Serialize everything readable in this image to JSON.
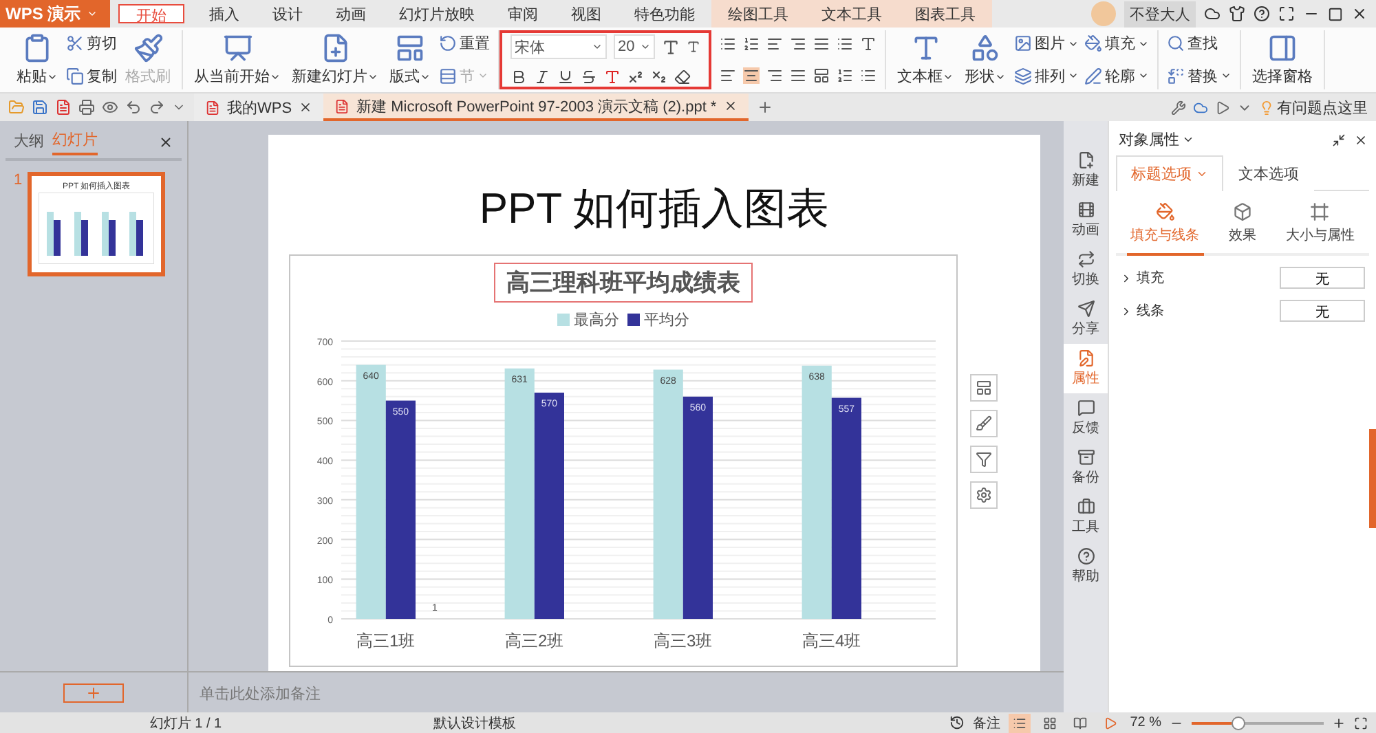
{
  "app": {
    "name": "WPS 演示"
  },
  "ribbon_tabs": [
    {
      "label": "开始",
      "selected": true,
      "kind": "normal"
    },
    {
      "label": "插入",
      "selected": false,
      "kind": "normal"
    },
    {
      "label": "设计",
      "selected": false,
      "kind": "normal"
    },
    {
      "label": "动画",
      "selected": false,
      "kind": "normal"
    },
    {
      "label": "幻灯片放映",
      "selected": false,
      "kind": "normal"
    },
    {
      "label": "审阅",
      "selected": false,
      "kind": "normal"
    },
    {
      "label": "视图",
      "selected": false,
      "kind": "normal"
    },
    {
      "label": "特色功能",
      "selected": false,
      "kind": "normal"
    },
    {
      "label": "绘图工具",
      "selected": false,
      "kind": "context"
    },
    {
      "label": "文本工具",
      "selected": false,
      "kind": "context"
    },
    {
      "label": "图表工具",
      "selected": false,
      "kind": "context"
    }
  ],
  "user": {
    "name": "不登大人"
  },
  "ribbon": [
    {
      "kind": "buttons",
      "items": [
        {
          "label": "粘贴",
          "kind": "large",
          "dropdown": true,
          "disabled": false
        },
        {
          "label": "剪切",
          "kind": "small",
          "dropdown": false,
          "disabled": false
        },
        {
          "label": "复制",
          "kind": "small",
          "dropdown": false,
          "disabled": false
        },
        {
          "label": "格式刷",
          "kind": "large",
          "dropdown": false,
          "disabled": true
        }
      ]
    },
    {
      "kind": "buttons",
      "items": [
        {
          "label": "从当前开始",
          "kind": "large",
          "dropdown": true,
          "disabled": false
        },
        {
          "label": "新建幻灯片",
          "kind": "large",
          "dropdown": true,
          "disabled": false
        },
        {
          "label": "版式",
          "kind": "large",
          "dropdown": true,
          "disabled": false
        },
        {
          "label": "重置",
          "kind": "small",
          "dropdown": false,
          "disabled": false
        },
        {
          "label": "节",
          "kind": "small",
          "dropdown": true,
          "disabled": true
        }
      ]
    },
    {
      "kind": "font",
      "font_name": "宋体",
      "font_size": "20"
    },
    {
      "kind": "paragraph"
    },
    {
      "kind": "buttons",
      "items": [
        {
          "label": "文本框",
          "kind": "large",
          "dropdown": true,
          "disabled": false
        },
        {
          "label": "形状",
          "kind": "large",
          "dropdown": true,
          "disabled": false
        },
        {
          "label": "图片",
          "kind": "small",
          "dropdown": true,
          "disabled": false
        },
        {
          "label": "排列",
          "kind": "small",
          "dropdown": true,
          "disabled": false
        },
        {
          "label": "填充",
          "kind": "small",
          "dropdown": true,
          "disabled": false
        },
        {
          "label": "轮廓",
          "kind": "small",
          "dropdown": true,
          "disabled": false
        }
      ]
    },
    {
      "kind": "buttons",
      "items": [
        {
          "label": "查找",
          "kind": "small",
          "dropdown": false,
          "disabled": false
        },
        {
          "label": "替换",
          "kind": "small",
          "dropdown": true,
          "disabled": false
        }
      ]
    },
    {
      "kind": "buttons",
      "items": [
        {
          "label": "选择窗格",
          "kind": "large",
          "dropdown": false,
          "disabled": false
        }
      ]
    }
  ],
  "doc_tabs": [
    {
      "label": "我的WPS",
      "selected": false
    },
    {
      "label": "新建 Microsoft PowerPoint 97-2003 演示文稿 (2).ppt *",
      "selected": true
    }
  ],
  "help_link": "有问题点这里",
  "left_panel": {
    "tabs": [
      {
        "label": "大纲",
        "selected": false
      },
      {
        "label": "幻灯片",
        "selected": true
      }
    ],
    "slides": [
      {
        "number": "1",
        "thumbnail_title": "PPT 如何插入图表",
        "selected": true
      }
    ]
  },
  "slide": {
    "title": "PPT 如何插入图表",
    "chart": {
      "chart_data": {
        "type": "bar",
        "title": "高三理科班平均成绩表",
        "categories": [
          "高三1班",
          "高三2班",
          "高三3班",
          "高三4班"
        ],
        "series": [
          {
            "name": "最高分",
            "color": "#b7e0e3",
            "values": [
              640,
              631,
              628,
              638
            ]
          },
          {
            "name": "平均分",
            "color": "#333399",
            "values": [
              550,
              570,
              560,
              557
            ]
          }
        ],
        "ylim": [
          0,
          700
        ],
        "grid": true,
        "legend": "top",
        "yticks": [
          0,
          100,
          200,
          300,
          400,
          500,
          600,
          700
        ],
        "data_labels": true,
        "annotations": [
          "1"
        ]
      }
    }
  },
  "notes": {
    "placeholder": "单击此处添加备注"
  },
  "side_nav": [
    {
      "label": "新建",
      "selected": false
    },
    {
      "label": "动画",
      "selected": false
    },
    {
      "label": "切换",
      "selected": false
    },
    {
      "label": "分享",
      "selected": false
    },
    {
      "label": "属性",
      "selected": true
    },
    {
      "label": "反馈",
      "selected": false
    },
    {
      "label": "备份",
      "selected": false
    },
    {
      "label": "工具",
      "selected": false
    },
    {
      "label": "帮助",
      "selected": false
    }
  ],
  "properties": {
    "title": "对象属性",
    "tabs": [
      {
        "label": "标题选项",
        "selected": true
      },
      {
        "label": "文本选项",
        "selected": false
      }
    ],
    "subtabs": [
      {
        "label": "填充与线条",
        "selected": true
      },
      {
        "label": "效果",
        "selected": false
      },
      {
        "label": "大小与属性",
        "selected": false
      }
    ],
    "rows": [
      {
        "label": "填充",
        "value": "无",
        "expanded": false
      },
      {
        "label": "线条",
        "value": "无",
        "expanded": false
      }
    ]
  },
  "status_bar": {
    "slide_info": "幻灯片 1 / 1",
    "template": "默认设计模板",
    "notes_button": "备注",
    "zoom": "72 %",
    "zoom_slider": {
      "level": 0.35
    }
  }
}
